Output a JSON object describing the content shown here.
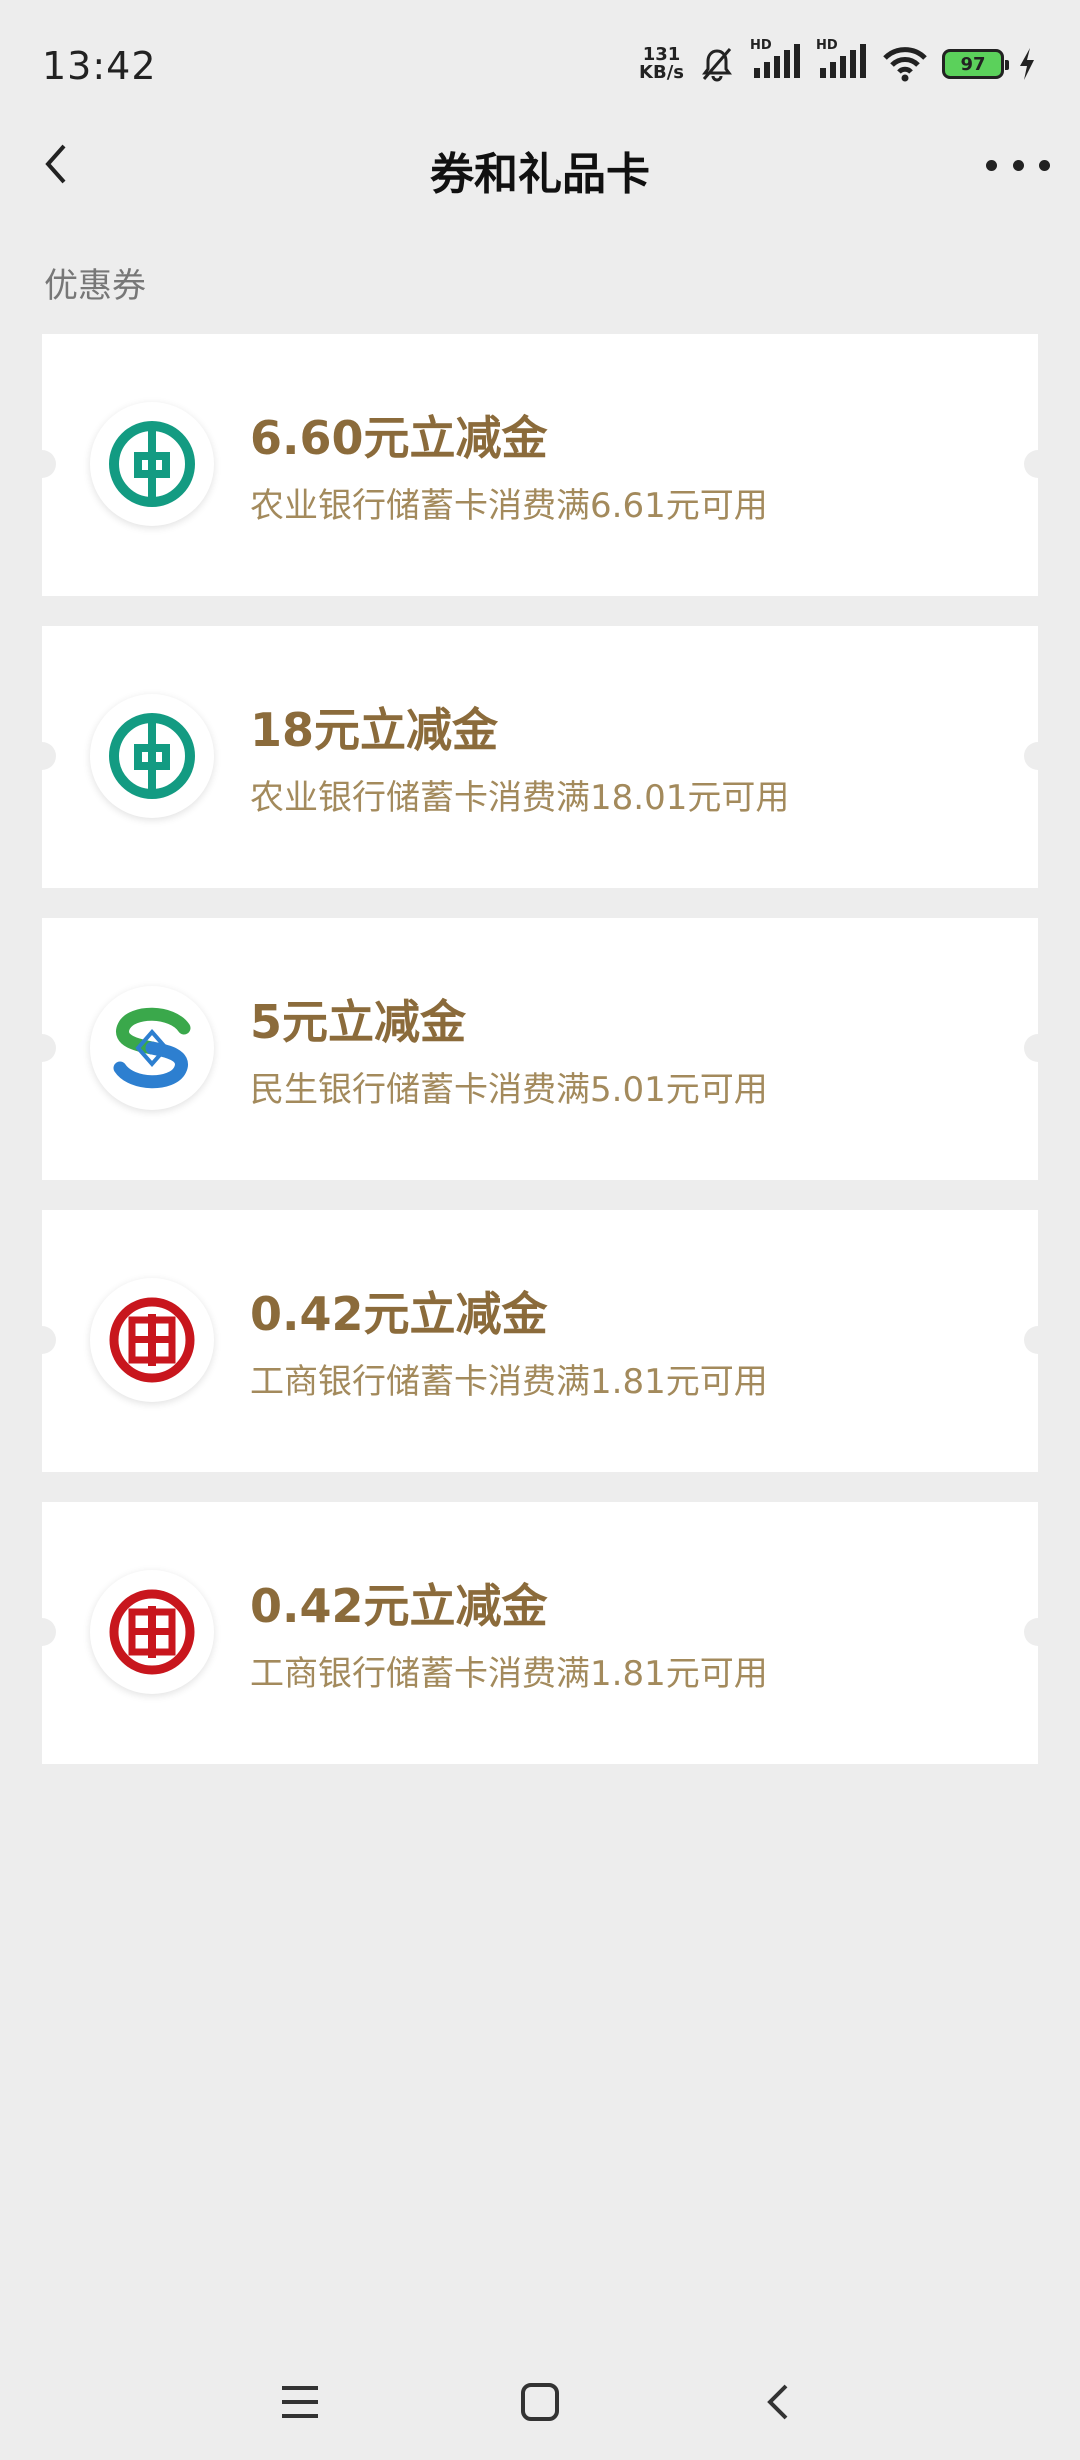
{
  "status": {
    "time": "13:42",
    "net_speed_value": "131",
    "net_speed_unit": "KB/s",
    "hd1": "HD",
    "hd2": "HD",
    "battery": "97"
  },
  "nav": {
    "title": "券和礼品卡"
  },
  "section": {
    "label": "优惠券"
  },
  "coupons": [
    {
      "title": "6.60元立减金",
      "desc": "农业银行储蓄卡消费满6.61元可用",
      "bank_icon": "abc-bank-logo",
      "color": "#139b82"
    },
    {
      "title": "18元立减金",
      "desc": "农业银行储蓄卡消费满18.01元可用",
      "bank_icon": "abc-bank-logo",
      "color": "#139b82"
    },
    {
      "title": "5元立减金",
      "desc": "民生银行储蓄卡消费满5.01元可用",
      "bank_icon": "cmbc-bank-logo",
      "color": "#2d7fd0"
    },
    {
      "title": "0.42元立减金",
      "desc": "工商银行储蓄卡消费满1.81元可用",
      "bank_icon": "icbc-bank-logo",
      "color": "#c8161d"
    },
    {
      "title": "0.42元立减金",
      "desc": "工商银行储蓄卡消费满1.81元可用",
      "bank_icon": "icbc-bank-logo",
      "color": "#c8161d"
    }
  ],
  "colors": {
    "background": "#ededed",
    "coupon_title": "#8b6b3b",
    "coupon_desc": "#a38a5c"
  }
}
